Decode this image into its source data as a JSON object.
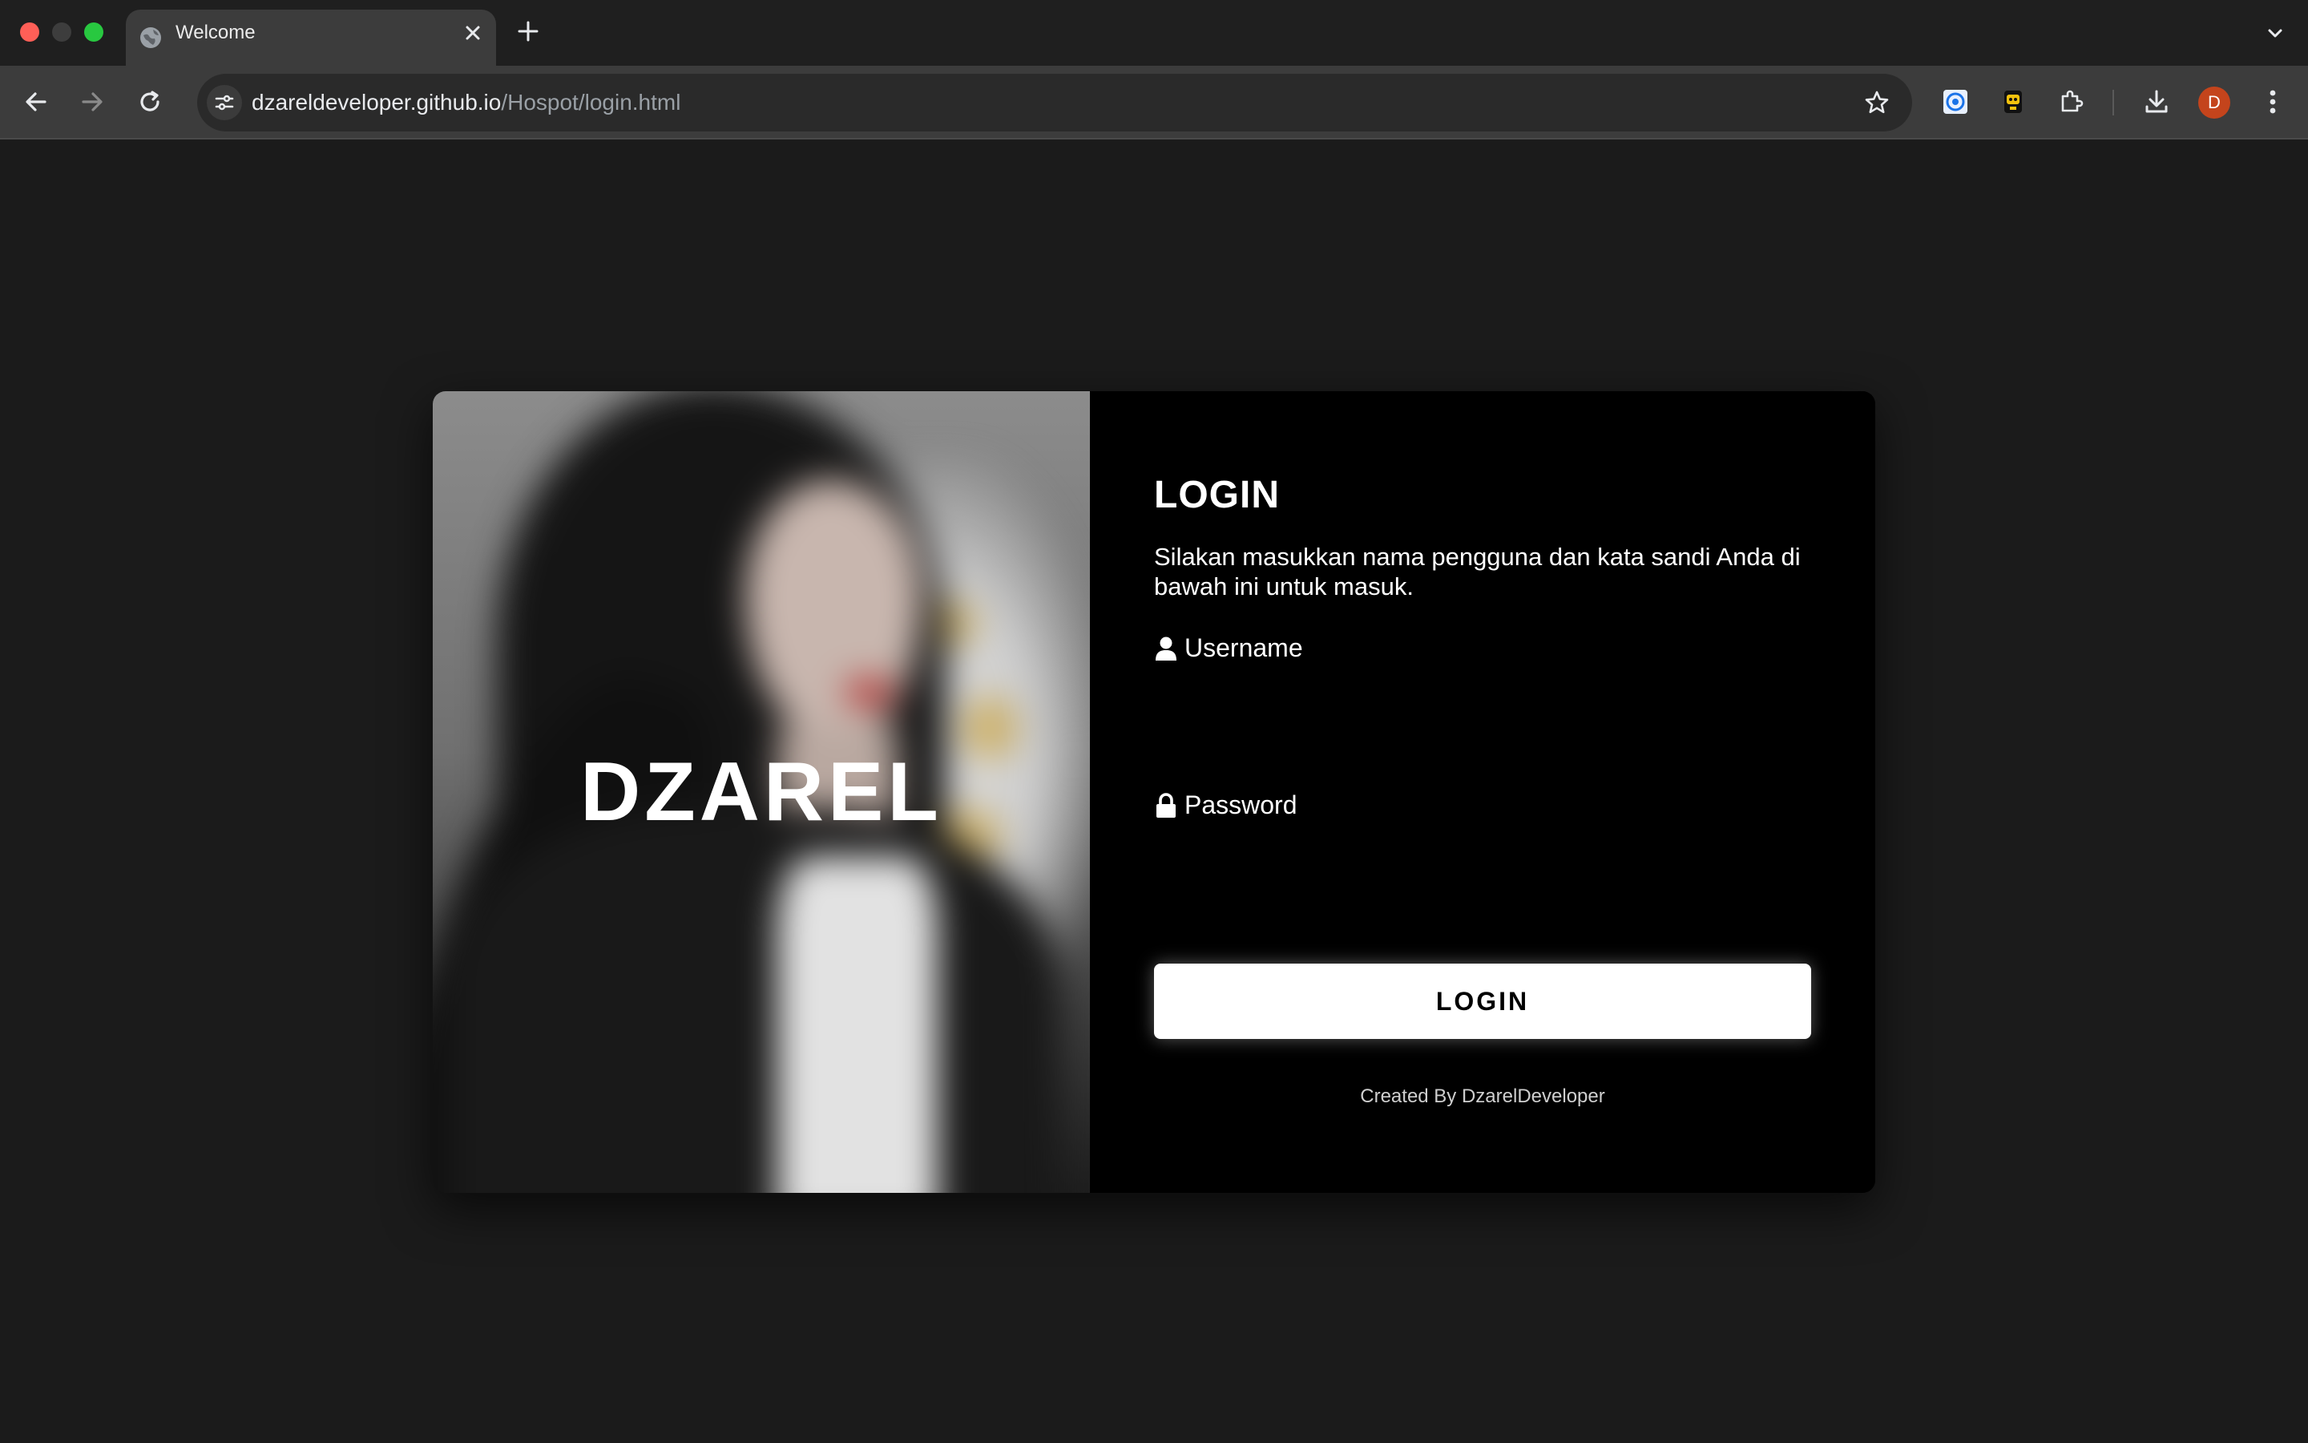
{
  "browser": {
    "tab": {
      "title": "Welcome"
    },
    "address_bar": {
      "host": "dzareldeveloper.github.io",
      "path": "/Hospot/login.html"
    },
    "profile_initial": "D"
  },
  "hero": {
    "brand_text": "DZAREL"
  },
  "login": {
    "heading": "LOGIN",
    "description": "Silakan masukkan nama pengguna dan kata sandi Anda di bawah ini untuk masuk.",
    "username_label": "Username",
    "username_value": "",
    "password_label": "Password",
    "password_value": "",
    "submit_label": "LOGIN",
    "credit": "Created By DzarelDeveloper"
  },
  "colors": {
    "page_background": "#1b1b1b",
    "panel_background": "#000000",
    "button_background": "#ffffff",
    "button_text": "#000000"
  },
  "icons": {
    "username": "user-icon",
    "password": "lock-icon"
  }
}
